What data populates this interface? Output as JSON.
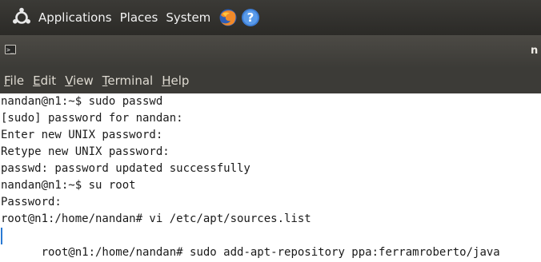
{
  "panel": {
    "menus": [
      "Applications",
      "Places",
      "System"
    ],
    "icons": [
      "ubuntu-logo-icon",
      "firefox-icon",
      "help-icon"
    ]
  },
  "window": {
    "title_fragment": "n"
  },
  "menubar": {
    "items": [
      {
        "mnemonic": "F",
        "rest": "ile"
      },
      {
        "mnemonic": "E",
        "rest": "dit"
      },
      {
        "mnemonic": "V",
        "rest": "iew"
      },
      {
        "mnemonic": "T",
        "rest": "erminal"
      },
      {
        "mnemonic": "H",
        "rest": "elp"
      }
    ]
  },
  "terminal": {
    "lines": [
      "nandan@n1:~$ sudo passwd",
      "[sudo] password for nandan:",
      "Enter new UNIX password:",
      "Retype new UNIX password:",
      "passwd: password updated successfully",
      "nandan@n1:~$ su root",
      "Password:",
      "root@n1:/home/nandan# vi /etc/apt/sources.list",
      "root@n1:/home/nandan# sudo add-apt-repository ppa:ferramroberto/java"
    ]
  }
}
